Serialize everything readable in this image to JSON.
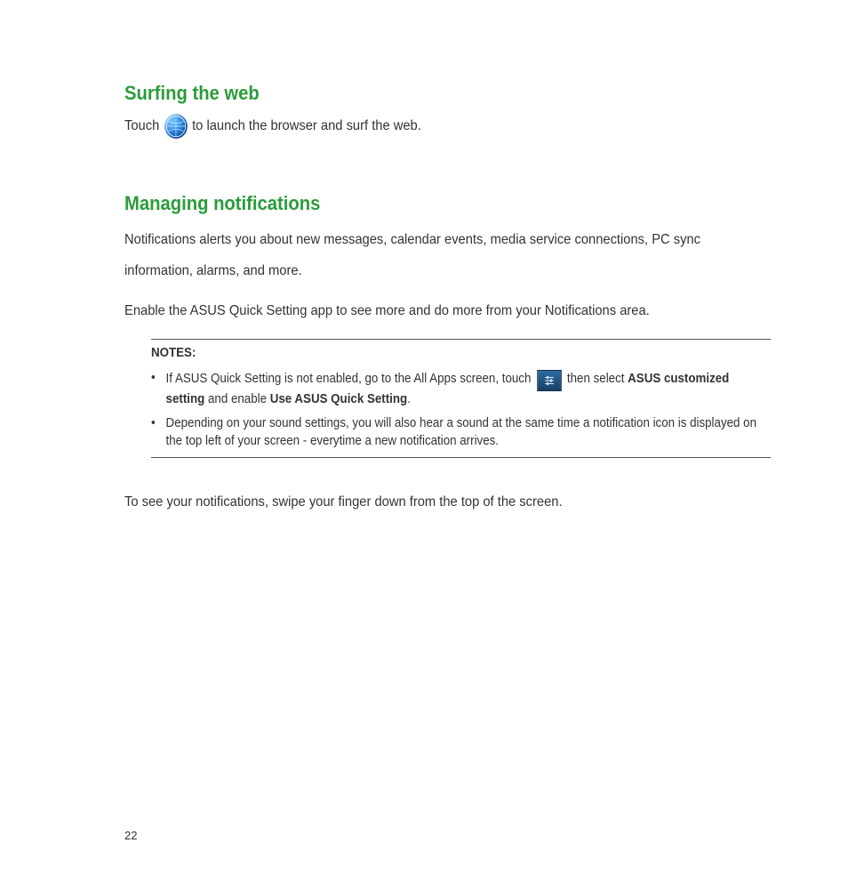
{
  "section1": {
    "heading": "Surfing the web",
    "line_before": "Touch",
    "line_after": "to launch the browser and surf the web."
  },
  "section2": {
    "heading": "Managing notifications",
    "para1": "Notifications alerts you about new messages, calendar events, media service connections, PC sync information, alarms, and more.",
    "para2": "Enable the ASUS Quick Setting app to see more and do more from your Notifications area."
  },
  "notes": {
    "header": "NOTES:",
    "item1": {
      "t1": "If ASUS Quick Setting is not enabled, go to the All Apps screen, touch",
      "t2": "then select",
      "b1": "ASUS customized setting",
      "t3": "and enable",
      "b2": "Use ASUS Quick Setting",
      "t4": "."
    },
    "item2": "Depending on your sound settings, you will also hear a sound at the same time a notification icon is displayed on the top left of your screen - everytime a new notification arrives."
  },
  "closing": "To see your notifications, swipe your finger down from the top of the screen.",
  "page_number": "22"
}
